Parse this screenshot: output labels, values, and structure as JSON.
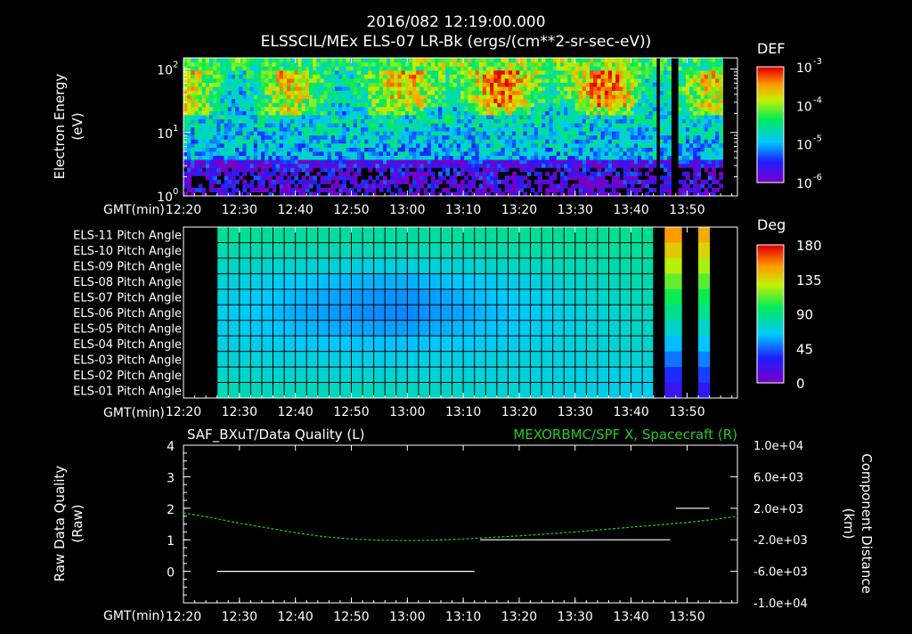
{
  "header": {
    "line1": "2016/082 12:19:00.000",
    "line2": "ELSSCIL/MEx ELS-07 LR-Bk  (ergs/(cm**2-sr-sec-eV))"
  },
  "colors": {
    "background": "#000000",
    "axis": "#ffffff",
    "spacecraft_line": "#22cc22"
  },
  "chart_data": [
    {
      "type": "heatmap",
      "title": "ELSSCIL/MEx ELS-07 LR-Bk  (ergs/(cm**2-sr-sec-eV))",
      "ylabel": "Electron Energy (eV)",
      "ylabel_lines": [
        "Electron Energy",
        "(eV)"
      ],
      "yscale": "log",
      "ylim": [
        1,
        150
      ],
      "yticks": [
        1,
        10,
        100
      ],
      "yticklabels": [
        "10",
        "10",
        "10"
      ],
      "yticksup": [
        "0",
        "1",
        "2"
      ],
      "xlabel": "GMT(min)",
      "xlim": [
        "12:20",
        "13:59"
      ],
      "xticks": [
        "12:20",
        "12:30",
        "12:40",
        "12:50",
        "13:00",
        "13:10",
        "13:20",
        "13:30",
        "13:40",
        "13:50"
      ],
      "colorbar": {
        "label": "DEF",
        "scale": "log",
        "range": [
          1e-06,
          0.001
        ],
        "ticklabels": [
          "10",
          "10",
          "10",
          "10"
        ],
        "ticksup": [
          "-3",
          "-4",
          "-5",
          "-6"
        ],
        "tickvalues": [
          0.001,
          0.0001,
          1e-05,
          1e-06
        ]
      },
      "data_gaps": [
        [
          "13:44",
          "13:45"
        ],
        [
          "13:47",
          "13:48"
        ],
        [
          "13:56",
          "13:59"
        ]
      ]
    },
    {
      "type": "heatmap",
      "xlabel": "GMT(min)",
      "xlim": [
        "12:20",
        "13:59"
      ],
      "xticks": [
        "12:20",
        "12:30",
        "12:40",
        "12:50",
        "13:00",
        "13:10",
        "13:20",
        "13:30",
        "13:40",
        "13:50"
      ],
      "rows": [
        "ELS-11 Pitch Angle",
        "ELS-10 Pitch Angle",
        "ELS-09 Pitch Angle",
        "ELS-08 Pitch Angle",
        "ELS-07 Pitch Angle",
        "ELS-06 Pitch Angle",
        "ELS-05 Pitch Angle",
        "ELS-04 Pitch Angle",
        "ELS-03 Pitch Angle",
        "ELS-02 Pitch Angle",
        "ELS-01 Pitch Angle"
      ],
      "colorbar": {
        "label": "Deg",
        "range": [
          0,
          180
        ],
        "ticklabels": [
          "180",
          "135",
          "90",
          "45",
          "0"
        ],
        "tickvalues": [
          180,
          135,
          90,
          45,
          0
        ]
      },
      "data_start": "12:26",
      "row_values_start": [
        90,
        85,
        80,
        75,
        72,
        70,
        70,
        72,
        75,
        78,
        82
      ],
      "row_values_mid": [
        88,
        82,
        72,
        58,
        52,
        50,
        55,
        62,
        70,
        75,
        80
      ],
      "row_values_end": [
        92,
        90,
        88,
        86,
        85,
        82,
        80,
        78,
        75,
        70,
        68
      ],
      "late_bursts": [
        {
          "start": "13:46",
          "end": "13:49",
          "top_value": 170,
          "bottom_value": 15
        },
        {
          "start": "13:52",
          "end": "13:54",
          "top_value": 165,
          "bottom_value": 20
        }
      ],
      "data_gaps": [
        [
          "13:44",
          "13:46"
        ],
        [
          "13:49",
          "13:52"
        ],
        [
          "13:54",
          "13:59"
        ]
      ]
    },
    {
      "type": "line",
      "title_left": "SAF_BXuT/Data Quality (L)",
      "title_right": "MEXORBMC/SPF X, Spacecraft (R)",
      "ylabel_left_lines": [
        "Raw Data Quality",
        "(Raw)"
      ],
      "ylabel_right_lines": [
        "Component Distance",
        "(km)"
      ],
      "xlabel": "GMT(min)",
      "xlim": [
        "12:20",
        "13:59"
      ],
      "xticks": [
        "12:20",
        "12:30",
        "12:40",
        "12:50",
        "13:00",
        "13:10",
        "13:20",
        "13:30",
        "13:40",
        "13:50"
      ],
      "ylim_left": [
        -1,
        4
      ],
      "yticks_left": [
        0,
        1,
        2,
        3,
        4
      ],
      "ylim_right": [
        -10000,
        10000
      ],
      "yticks_right": [
        10000,
        6000,
        2000,
        -2000,
        -6000,
        -10000
      ],
      "yticklabels_right": [
        "1.0e+04",
        "6.0e+03",
        "2.0e+03",
        "-2.0e+03",
        "-6.0e+03",
        "-1.0e+04"
      ],
      "series": [
        {
          "axis": "left",
          "color": "#ffffff",
          "segments": [
            {
              "x": [
                "12:26",
                "13:12"
              ],
              "y": [
                0,
                0
              ]
            },
            {
              "x": [
                "13:13",
                "13:47"
              ],
              "y": [
                1,
                1
              ]
            },
            {
              "x": [
                "13:48",
                "13:54"
              ],
              "y": [
                2,
                2
              ]
            }
          ]
        },
        {
          "axis": "right",
          "color": "#22cc22",
          "x": [
            "12:20",
            "12:25",
            "12:30",
            "12:35",
            "12:40",
            "12:45",
            "12:50",
            "12:55",
            "13:00",
            "13:05",
            "13:10",
            "13:15",
            "13:20",
            "13:25",
            "13:30",
            "13:35",
            "13:40",
            "13:45",
            "13:50",
            "13:55",
            "13:59"
          ],
          "y": [
            1400,
            800,
            100,
            -500,
            -1100,
            -1600,
            -1900,
            -2050,
            -2100,
            -2050,
            -1900,
            -1700,
            -1500,
            -1250,
            -1000,
            -700,
            -400,
            -100,
            200,
            600,
            1000
          ]
        }
      ]
    }
  ]
}
